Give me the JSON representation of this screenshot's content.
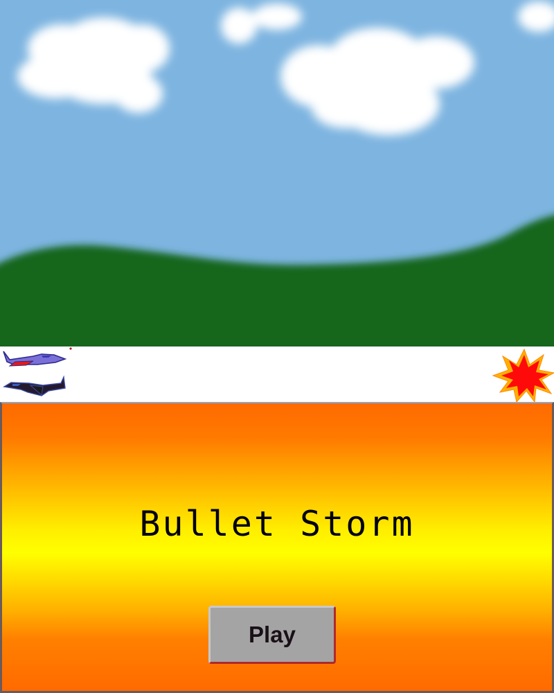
{
  "game": {
    "title": "Bullet Storm",
    "play_label": "Play"
  },
  "colors": {
    "sky": "#7db4e0",
    "hills": "#17661f",
    "cloud": "#ffffff",
    "menu_orange": "#ff6a00",
    "menu_yellow": "#ffff00",
    "button_gray": "#a4a4a4"
  },
  "sprites": {
    "player_jet": "blue-red-jet",
    "enemy_jet": "dark-jet",
    "explosion": "red-yellow-starburst"
  }
}
